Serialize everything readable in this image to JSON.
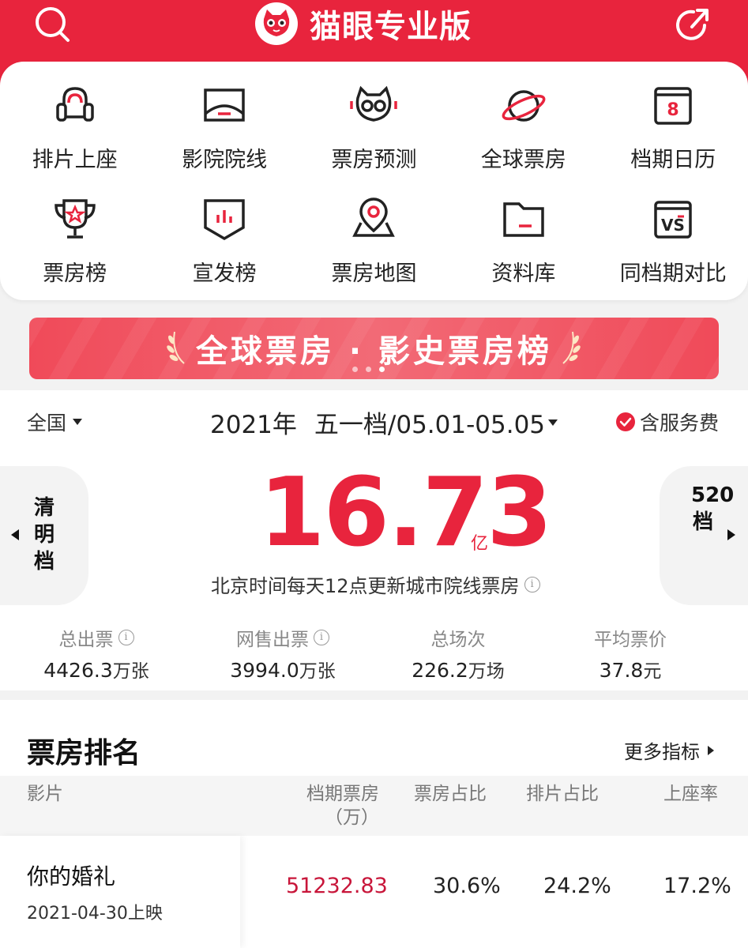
{
  "app": {
    "title": "猫眼专业版",
    "accent_color": "#e8243d"
  },
  "header": {
    "left_icon": "search-icon",
    "right_icon": "share-icon"
  },
  "menu": {
    "items": [
      {
        "label": "排片上座",
        "icon": "seat-icon"
      },
      {
        "label": "影院院线",
        "icon": "screen-icon"
      },
      {
        "label": "票房预测",
        "icon": "owl-icon"
      },
      {
        "label": "全球票房",
        "icon": "planet-icon"
      },
      {
        "label": "档期日历",
        "icon": "calendar-icon"
      },
      {
        "label": "票房榜",
        "icon": "trophy-icon"
      },
      {
        "label": "宣发榜",
        "icon": "banner-chart-icon"
      },
      {
        "label": "票房地图",
        "icon": "map-pin-icon"
      },
      {
        "label": "资料库",
        "icon": "folder-icon"
      },
      {
        "label": "同档期对比",
        "icon": "vs-icon"
      }
    ]
  },
  "banner": {
    "text": "全球票房 · 影史票房榜",
    "active_dot": 2,
    "dot_count": 3
  },
  "filters": {
    "region": "全国",
    "year": "2021年",
    "period": "五一档/05.01-05.05",
    "service_fee": "含服务费"
  },
  "summary": {
    "prev_period": "清明档",
    "next_period": "520档",
    "total": "16.73",
    "total_unit": "亿",
    "note": "北京时间每天12点更新城市院线票房"
  },
  "stats": [
    {
      "label": "总出票",
      "value": "4426.3",
      "unit": "万张",
      "info": true
    },
    {
      "label": "网售出票",
      "value": "3994.0",
      "unit": "万张",
      "info": true
    },
    {
      "label": "总场次",
      "value": "226.2",
      "unit": "万场",
      "info": false
    },
    {
      "label": "平均票价",
      "value": "37.8",
      "unit": "元",
      "info": false
    }
  ],
  "ranking": {
    "title": "票房排名",
    "more": "更多指标",
    "columns": {
      "film": "影片",
      "box_line1": "档期票房",
      "box_line2": "（万）",
      "share": "票房占比",
      "schedule": "排片占比",
      "occupancy": "上座率"
    },
    "rows": [
      {
        "name": "你的婚礼",
        "release": "2021-04-30上映",
        "box": "51232.83",
        "share": "30.6%",
        "schedule": "24.2%",
        "occupancy": "17.2%"
      }
    ]
  }
}
